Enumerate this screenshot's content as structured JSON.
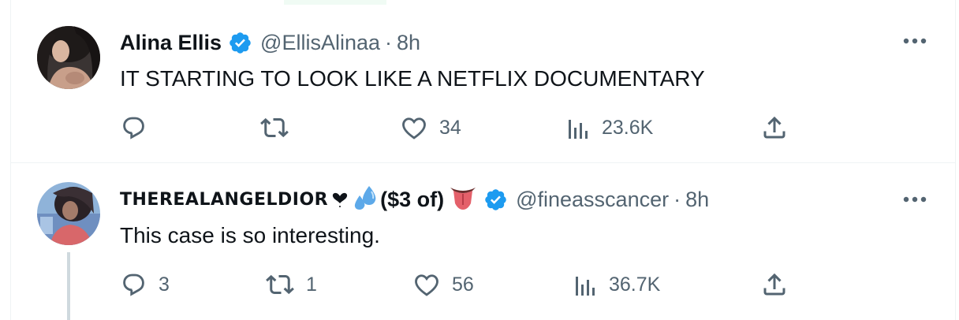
{
  "tweets": [
    {
      "name": "Alina Ellis",
      "handle": "@EllisAlinaa",
      "separator": "·",
      "time": "8h",
      "text": "IT STARTING TO LOOK LIKE A NETFLIX DOCUMENTARY",
      "replies": "",
      "retweets": "",
      "likes": "34",
      "views": "23.6K",
      "verified": true
    },
    {
      "name": "THEREALANGELDIOR",
      "name_suffix": "($3 of)",
      "name_emojis": [
        "heart-exclamation-icon",
        "sweat-droplets-icon",
        "tongue-icon"
      ],
      "handle": "@fineasscancer",
      "separator": "·",
      "time": "8h",
      "text": "This case is so interesting.",
      "replies": "3",
      "retweets": "1",
      "likes": "56",
      "views": "36.7K",
      "verified": true
    }
  ],
  "colors": {
    "verified_blue": "#1d9bf0",
    "secondary_text": "#536471",
    "primary_text": "#0f1419",
    "divider": "#eff3f4",
    "thread_line": "#cfd9de"
  }
}
